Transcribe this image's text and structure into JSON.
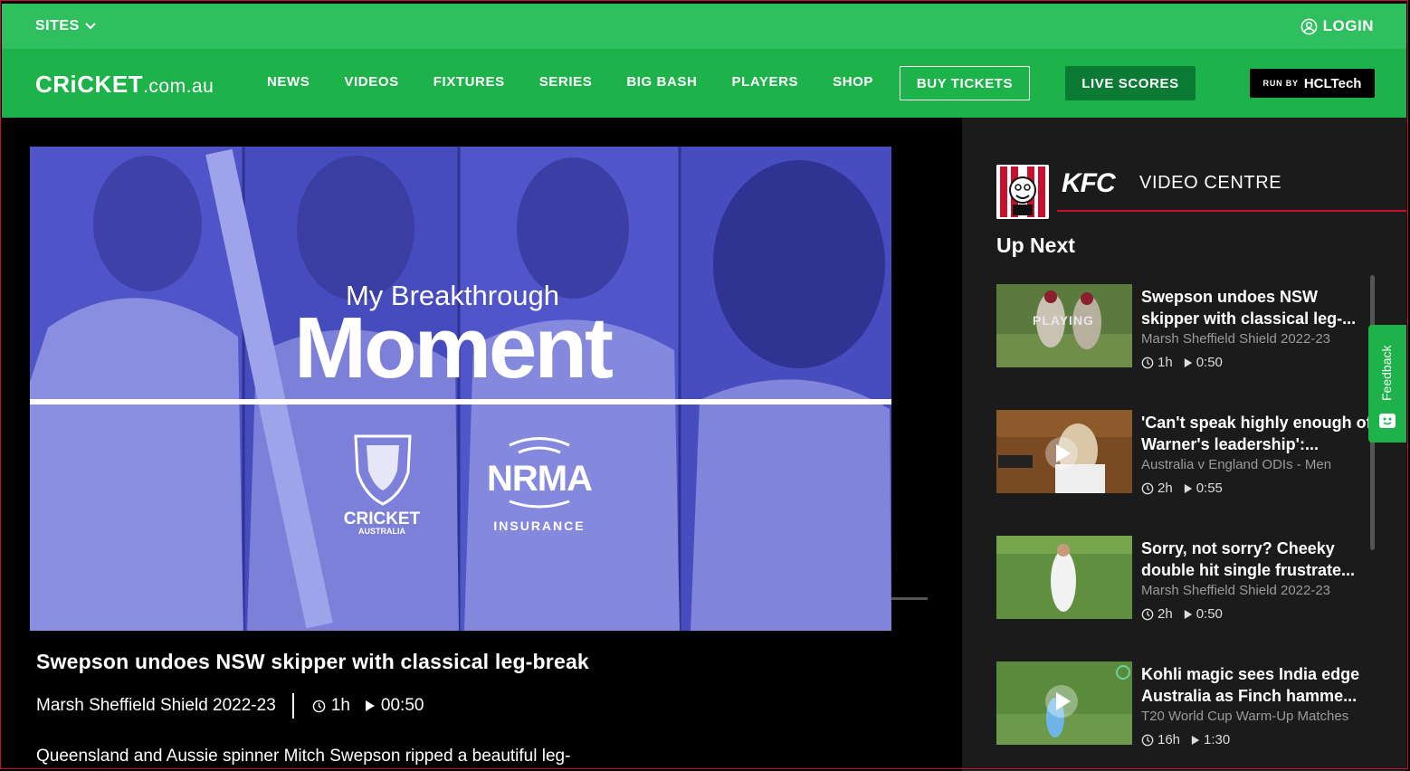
{
  "topbar": {
    "sites_label": "SITES",
    "login_label": "LOGIN"
  },
  "nav": {
    "logo_main": "CRiCKET",
    "logo_domain": ".com.au",
    "links": [
      "NEWS",
      "VIDEOS",
      "FIXTURES",
      "SERIES",
      "BIG BASH",
      "PLAYERS",
      "SHOP"
    ],
    "buy_tickets": "BUY TICKETS",
    "live_scores": "LIVE SCORES",
    "sponsor_run": "RUN BY",
    "sponsor_name": "HCLTech"
  },
  "player": {
    "headline_small": "My Breakthrough",
    "headline_big": "Moment",
    "logo_ca_main": "CRICKET",
    "logo_ca_sub": "AUSTRALIA",
    "logo_nrma_main": "NRMA",
    "logo_nrma_sub": "INSURANCE"
  },
  "video": {
    "title": "Swepson undoes NSW skipper with classical leg-break",
    "series": "Marsh Sheffield Shield 2022-23",
    "age": "1h",
    "duration": "00:50",
    "description": "Queensland and Aussie spinner Mitch Swepson ripped a beautiful leg-"
  },
  "sidebar": {
    "brand": "KFC",
    "title": "VIDEO CENTRE",
    "up_next": "Up Next",
    "playing_label": "PLAYING",
    "items": [
      {
        "title": "Swepson undoes NSW skipper with classical leg-...",
        "series": "Marsh Sheffield Shield 2022-23",
        "age": "1h",
        "duration": "0:50"
      },
      {
        "title": "'Can't speak highly enough of Warner's leadership':...",
        "series": "Australia v England ODIs - Men",
        "age": "2h",
        "duration": "0:55"
      },
      {
        "title": "Sorry, not sorry? Cheeky double hit single frustrate...",
        "series": "Marsh Sheffield Shield 2022-23",
        "age": "2h",
        "duration": "0:50"
      },
      {
        "title": "Kohli magic sees India edge Australia as Finch hamme...",
        "series": "T20 World Cup Warm-Up Matches",
        "age": "16h",
        "duration": "1:30"
      }
    ]
  },
  "feedback": {
    "label": "Feedback"
  },
  "colors": {
    "brand_green": "#1db24a",
    "top_green": "#2fbf5f",
    "kfc_red": "#c8102e",
    "player_blue": "#4a4fc4"
  }
}
